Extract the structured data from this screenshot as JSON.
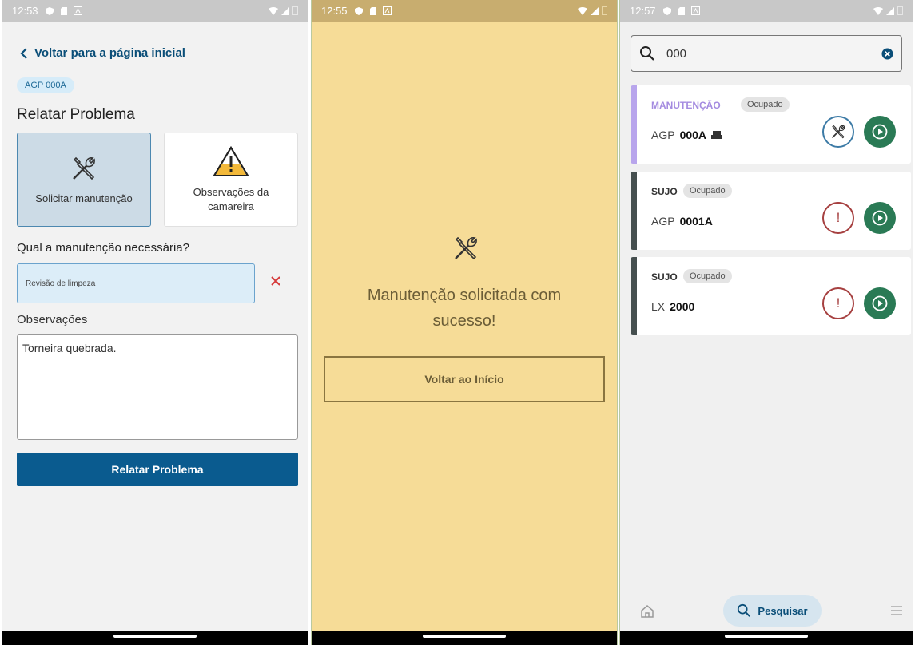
{
  "screen1": {
    "status": {
      "time": "12:53"
    },
    "back_label": "Voltar para a página inicial",
    "room_badge": "AGP 000A",
    "title": "Relatar Problema",
    "options": [
      {
        "label": "Solicitar manutenção",
        "selected": true
      },
      {
        "label": "Observações da camareira",
        "selected": false
      }
    ],
    "question": "Qual a manutenção necessária?",
    "maintenance_value": "Revisão de limpeza",
    "observations_label": "Observações",
    "observations_value": "Torneira quebrada.",
    "submit_label": "Relatar Problema"
  },
  "screen2": {
    "status": {
      "time": "12:55"
    },
    "message": "Manutenção solicitada com sucesso!",
    "button_label": "Voltar ao Início"
  },
  "screen3": {
    "status": {
      "time": "12:57"
    },
    "search_value": "000",
    "rooms": [
      {
        "status": "MANUTENÇÃO",
        "status_color": "#a48be0",
        "occupancy": "Ocupado",
        "prefix": "AGP",
        "number": "000A",
        "action": "maintenance",
        "bar_color": "#b8a5ec"
      },
      {
        "status": "SUJO",
        "status_color": "#333333",
        "occupancy": "Ocupado",
        "prefix": "AGP",
        "number": "0001A",
        "action": "alert",
        "bar_color": "#454f4f"
      },
      {
        "status": "SUJO",
        "status_color": "#333333",
        "occupancy": "Ocupado",
        "prefix": "LX",
        "number": "2000",
        "action": "alert",
        "bar_color": "#454f4f"
      }
    ],
    "tabs": {
      "search_label": "Pesquisar"
    }
  },
  "colors": {
    "primary": "#0a5b8f",
    "success_bg": "#f6dc97",
    "play_green": "#2a7a55",
    "alert_red": "#a64040"
  }
}
